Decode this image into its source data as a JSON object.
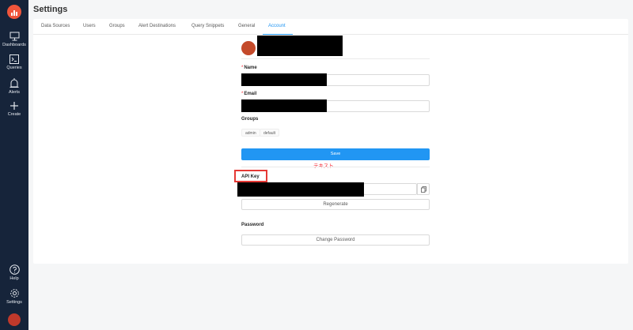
{
  "sidebar": {
    "items": [
      {
        "label": "Dashboards",
        "icon": "monitor-icon"
      },
      {
        "label": "Queries",
        "icon": "terminal-icon"
      },
      {
        "label": "Alerts",
        "icon": "alarm-icon"
      },
      {
        "label": "Create",
        "icon": "plus-icon"
      }
    ],
    "bottom": [
      {
        "label": "Help",
        "icon": "help-icon"
      },
      {
        "label": "Settings",
        "icon": "gear-icon"
      }
    ]
  },
  "page": {
    "title": "Settings"
  },
  "tabs": [
    "Data Sources",
    "Users",
    "Groups",
    "Alert Destinations",
    "Query Snippets",
    "General",
    "Account"
  ],
  "active_tab": "Account",
  "form": {
    "name_label": "Name",
    "email_label": "Email",
    "groups_label": "Groups",
    "groups": [
      "admin",
      "default"
    ],
    "save_label": "Save",
    "annotation": "テキスト",
    "api_key_label": "API Key",
    "regenerate_label": "Regenerate",
    "password_label": "Password",
    "change_password_label": "Change Password"
  },
  "colors": {
    "sidebar": "#16243a",
    "accent": "#2196f3",
    "highlight": "#e53935",
    "logo": "#f0553b"
  }
}
